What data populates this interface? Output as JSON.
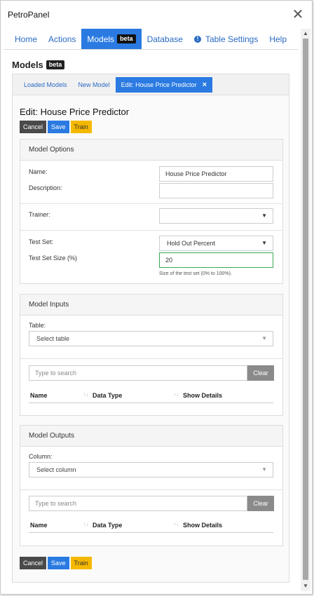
{
  "window": {
    "title": "PetroPanel"
  },
  "nav": {
    "items": [
      {
        "label": "Home"
      },
      {
        "label": "Actions"
      },
      {
        "label": "Models",
        "badge": "beta"
      },
      {
        "label": "Database"
      },
      {
        "label": "Table Settings"
      },
      {
        "label": "Help"
      }
    ]
  },
  "page": {
    "heading": "Models",
    "badge": "beta"
  },
  "tabs": [
    {
      "label": "Loaded Models"
    },
    {
      "label": "New Model"
    },
    {
      "label": "Edit: House Price Predictor",
      "close": "×"
    }
  ],
  "edit": {
    "heading": "Edit: House Price Predictor"
  },
  "actions": {
    "cancel": "Cancel",
    "save": "Save",
    "train": "Train"
  },
  "model_options": {
    "header": "Model Options",
    "name_label": "Name:",
    "name_value": "House Price Predictor",
    "description_label": "Description:",
    "description_value": "",
    "trainer_label": "Trainer:",
    "trainer_value": "",
    "test_set_label": "Test Set:",
    "test_set_value": "Hold Out Percent",
    "test_set_size_label": "Test Set Size (%)",
    "test_set_size_value": "20",
    "test_set_help": "Size of the test set (0% to 100%)."
  },
  "model_inputs": {
    "header": "Model Inputs",
    "table_label": "Table:",
    "table_placeholder": "Select table",
    "search_placeholder": "Type to search",
    "clear": "Clear",
    "columns": [
      "Name",
      "Data Type",
      "Show Details"
    ]
  },
  "model_outputs": {
    "header": "Model Outputs",
    "column_label": "Column:",
    "column_placeholder": "Select column",
    "search_placeholder": "Type to search",
    "clear": "Clear",
    "columns": [
      "Name",
      "Data Type",
      "Show Details"
    ]
  },
  "icons": {
    "close": "close-icon",
    "info": "info-icon",
    "dropdown": "chevron-down-icon",
    "sort": "sort-icon"
  },
  "colors": {
    "accent": "#2a7ae2",
    "train": "#f5b800",
    "cancel": "#4a4a4a",
    "valid": "#3aa655"
  }
}
